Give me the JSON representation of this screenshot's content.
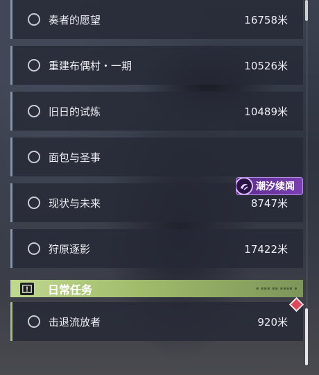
{
  "quests": [
    {
      "name": "奏者的愿望",
      "distance": "16758米"
    },
    {
      "name": "重建布偶村・一期",
      "distance": "10526米"
    },
    {
      "name": "旧日的试炼",
      "distance": "10489米"
    },
    {
      "name": "面包与圣事",
      "distance": ""
    },
    {
      "name": "现状与未来",
      "distance": "8747米"
    },
    {
      "name": "狩原逐影",
      "distance": "17422米"
    }
  ],
  "event_badge": {
    "label": "潮汐续闻",
    "icon": "tidal-emblem-icon"
  },
  "daily_section": {
    "title": "日常任务",
    "icon": "exclamation-icon",
    "quests": [
      {
        "name": "击退流放者",
        "distance": "920米"
      }
    ]
  },
  "colors": {
    "main_quest_accent": "#7f95b0",
    "daily_accent": "#a7c16b",
    "badge_purple": "#7a3fb3",
    "marker_red": "#e0455c"
  }
}
